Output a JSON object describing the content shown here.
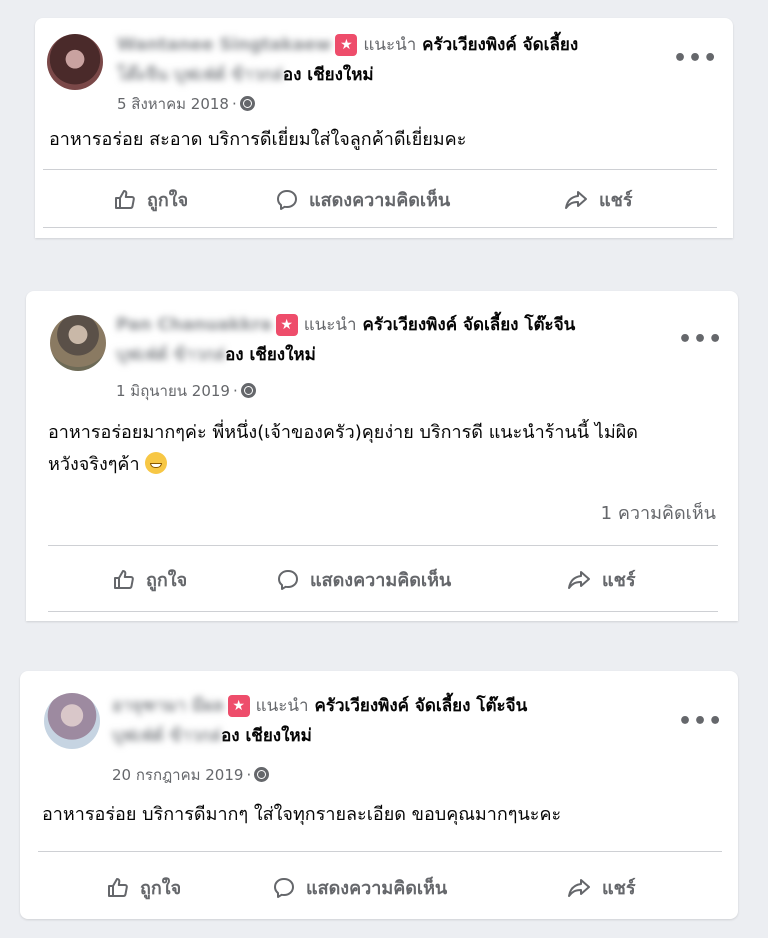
{
  "posts": [
    {
      "author": "Wantanee Singtakaew",
      "verb": "แนะนำ",
      "page_line1": "ครัวเวียงพิงค์ จัดเลี้ยง",
      "page_line2_blurred": "โต๊ะจีน บุฟเฟ่ต์ ข้าวกล่",
      "page_line2_visible": "อง เชียงใหม่",
      "date": "5 สิงหาคม 2018",
      "text": "อาหารอร่อย สะอาด บริการดีเยี่ยมใส่ใจลูกค้าดีเยี่ยมคะ",
      "like_label": "ถูกใจ",
      "comment_label": "แสดงความคิดเห็น",
      "share_label": "แชร์"
    },
    {
      "author": "Pan Chanuakkra",
      "verb": "แนะนำ",
      "page_line1": "ครัวเวียงพิงค์ จัดเลี้ยง โต๊ะจีน",
      "page_line2_blurred": "บุฟเฟ่ต์ ข้าวกล่",
      "page_line2_visible": "อง เชียงใหม่",
      "date": "1 มิถุนายน 2019",
      "text_line1": "อาหารอร่อยมากๆค่ะ พี่หนึ่ง(เจ้าของครัว)คุยง่าย บริการดี แนะนำร้านนี้ ไม่ผิด",
      "text_line2": "หวังจริงๆค้า",
      "comment_count": "1 ความคิดเห็น",
      "like_label": "ถูกใจ",
      "comment_label": "แสดงความคิดเห็น",
      "share_label": "แชร์"
    },
    {
      "author": "อาจุฑามา มีผล",
      "verb": "แนะนำ",
      "page_line1": "ครัวเวียงพิงค์ จัดเลี้ยง โต๊ะจีน",
      "page_line2_blurred": "บุฟเฟ่ต์ ข้าวกล่",
      "page_line2_visible": "อง เชียงใหม่",
      "date": "20 กรกฎาคม 2019",
      "text": "อาหารอร่อย บริการดีมากๆ ใส่ใจทุกรายละเอียด  ขอบคุณมากๆนะคะ",
      "like_label": "ถูกใจ",
      "comment_label": "แสดงความคิดเห็น",
      "share_label": "แชร์"
    }
  ],
  "colors": {
    "background": "#eceef2",
    "card": "#ffffff",
    "secondary_text": "#65676b",
    "badge": "#ee4d6b",
    "divider": "#ced0d4"
  },
  "icons": [
    "recommend-badge-icon",
    "globe-icon",
    "more-options-icon",
    "like-thumb-icon",
    "comment-bubble-icon",
    "share-arrow-icon",
    "grinning-emoji-icon"
  ]
}
